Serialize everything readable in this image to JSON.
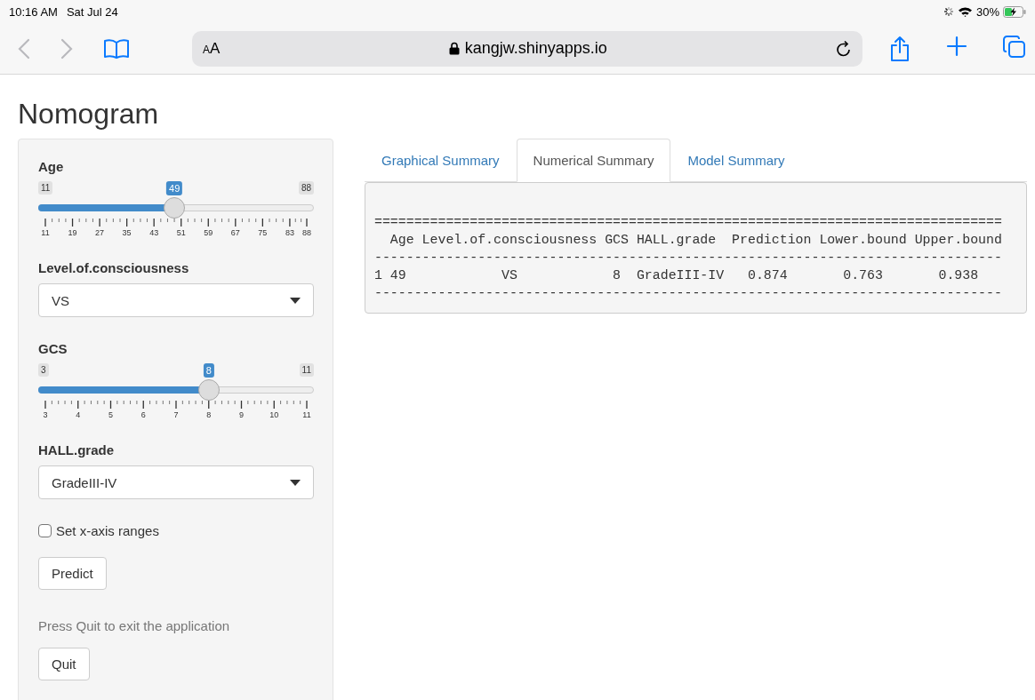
{
  "status_bar": {
    "time": "10:16 AM",
    "date": "Sat Jul 24",
    "battery": "30%"
  },
  "browser": {
    "text_size_button": "AA",
    "url": "kangjw.shinyapps.io"
  },
  "page": {
    "title": "Nomogram"
  },
  "sidebar": {
    "inputs": [
      {
        "kind": "slider",
        "label": "Age",
        "min": "11",
        "max": "88",
        "value": "49",
        "level": 0.494,
        "ticks": [
          "11",
          "19",
          "27",
          "35",
          "43",
          "51",
          "59",
          "67",
          "75",
          "83",
          "88"
        ]
      },
      {
        "kind": "select",
        "label": "Level.of.consciousness",
        "value": "VS"
      },
      {
        "kind": "slider",
        "label": "GCS",
        "min": "3",
        "max": "11",
        "value": "8",
        "level": 0.625,
        "ticks": [
          "3",
          "4",
          "5",
          "6",
          "7",
          "8",
          "9",
          "10",
          "11"
        ]
      },
      {
        "kind": "select",
        "label": "HALL.grade",
        "value": "GradeIII-IV"
      }
    ],
    "checkbox": {
      "label": "Set x-axis ranges",
      "checked": false
    },
    "predict_button": "Predict",
    "note": "Press Quit to exit the application",
    "quit_button": "Quit"
  },
  "tabs": [
    {
      "label": "Graphical Summary",
      "selected": false
    },
    {
      "label": "Numerical Summary",
      "selected": true
    },
    {
      "label": "Model Summary",
      "selected": false
    }
  ],
  "output": {
    "lines": [
      "===============================================================================",
      "  Age Level.of.consciousness GCS HALL.grade  Prediction Lower.bound Upper.bound",
      "-------------------------------------------------------------------------------",
      "1 49            VS            8  GradeIII-IV   0.874       0.763       0.938",
      "-------------------------------------------------------------------------------"
    ]
  }
}
